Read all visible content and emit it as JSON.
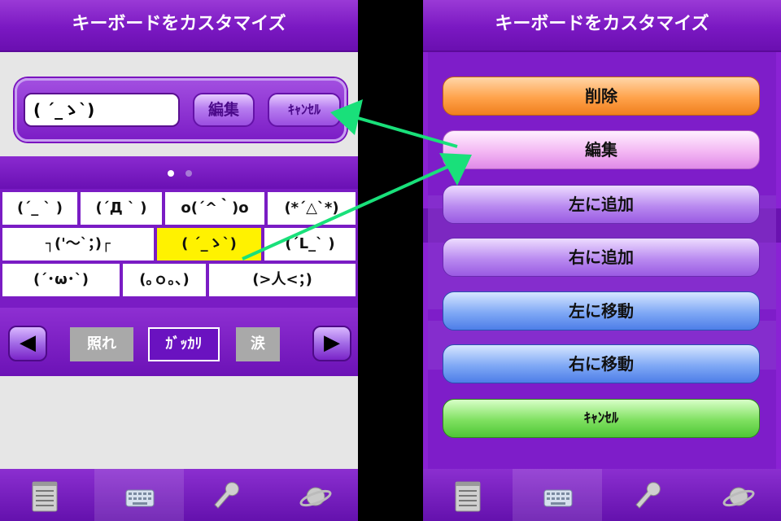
{
  "left_screen": {
    "title": "キーボードをカスタマイズ",
    "editor": {
      "value": "( ´_ゝ`)",
      "edit_label": "編集",
      "cancel_label": "ｷｬﾝｾﾙ"
    },
    "keyboard": {
      "rows": [
        [
          "(´_ ` )",
          "(´Д ` )",
          "o(´^｀)o",
          "(*´△`*)"
        ],
        [
          "┐('～`；)┌",
          "( ´_ゝ`)",
          "(´L_` )"
        ],
        [
          "(´･ω･`)",
          "(｡ｏ｡､)",
          "(>人<；)"
        ]
      ],
      "selected_key": "( ´_ゝ`)"
    },
    "categories": [
      "照れ",
      "ｶﾞｯｶﾘ",
      "涙"
    ],
    "active_category": "ｶﾞｯｶﾘ",
    "arrows": {
      "prev": "◀",
      "next": "▶"
    }
  },
  "right_screen": {
    "title": "キーボードをカスタマイズ",
    "menu": {
      "delete": "削除",
      "edit": "編集",
      "add_left": "左に追加",
      "add_right": "右に追加",
      "move_left": "左に移動",
      "move_right": "右に移動",
      "cancel": "ｷｬﾝｾﾙ"
    }
  },
  "tabs": [
    {
      "icon": "notepad-icon"
    },
    {
      "icon": "keyboard-icon",
      "active": true
    },
    {
      "icon": "wrench-icon"
    },
    {
      "icon": "planet-icon"
    }
  ],
  "colors": {
    "purple": "#7a1cc4",
    "highlight": "#fff200",
    "annotation_arrow": "#19e07a"
  }
}
